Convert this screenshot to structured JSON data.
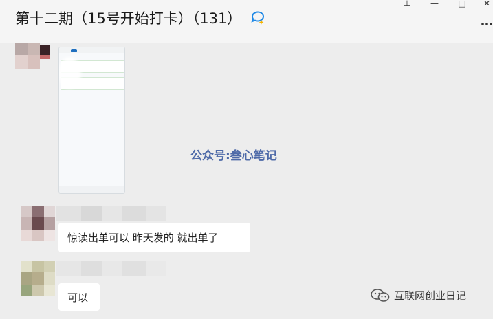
{
  "window": {
    "title": "第十二期（15号开始打卡）（131）",
    "controls": {
      "pin": "⊥",
      "minimize": "—",
      "maximize": "□",
      "close": "✕"
    }
  },
  "messages": [
    {
      "type": "image",
      "description_icon": "phone-screenshot"
    },
    {
      "type": "text",
      "text": "惊读出单可以 昨天发的 就出单了"
    },
    {
      "type": "text",
      "text": "可以"
    }
  ],
  "overlay": {
    "center_watermark": "公众号:叁心笔记",
    "corner_watermark": "互联网创业日记"
  },
  "colors": {
    "window_bg": "#ededed",
    "titlebar_bg": "#f5f5f5",
    "bubble_bg": "#ffffff",
    "watermark_blue": "#4e6aa8"
  }
}
